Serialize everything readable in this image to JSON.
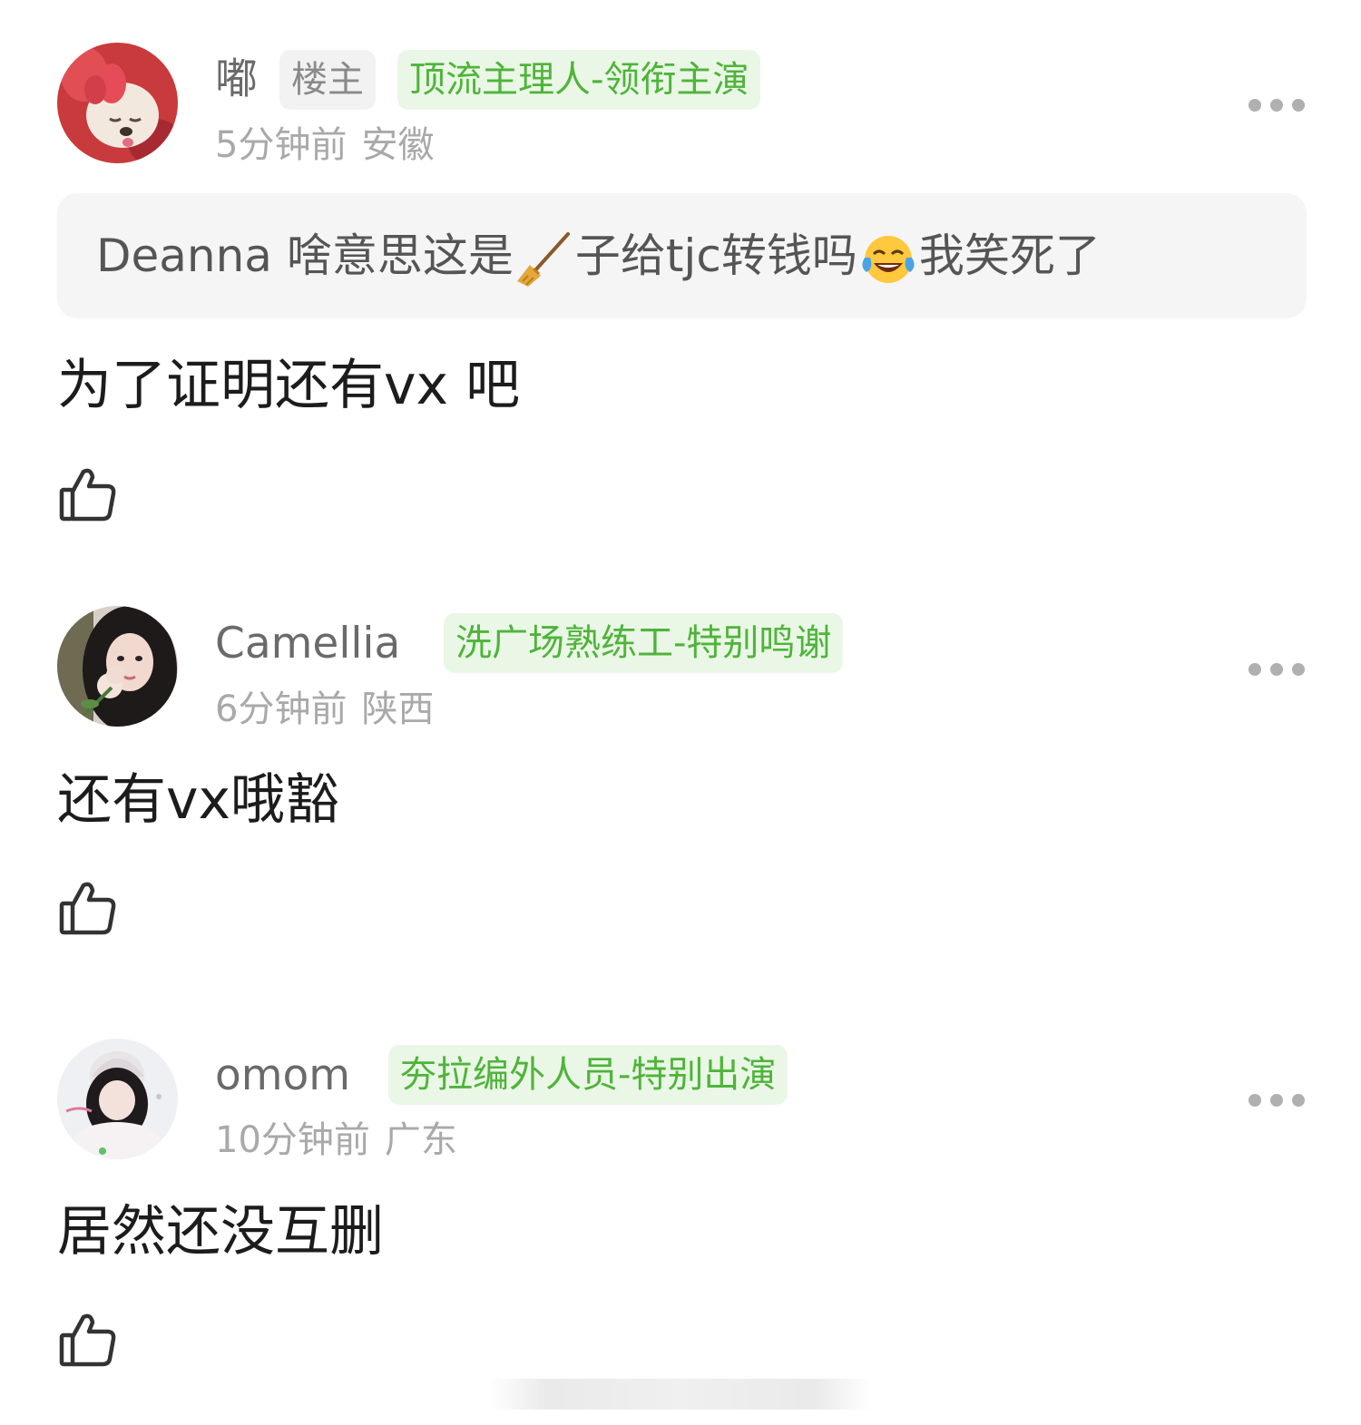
{
  "comments": [
    {
      "name": "嘟",
      "badges": [
        "楼主",
        "顶流主理人-领衔主演"
      ],
      "time": "5分钟前",
      "location": "安徽",
      "quote": {
        "author": "Deanna",
        "text_before": "啥意思这是",
        "emoji1": "broom-icon",
        "text_middle": "子给tjc转钱吗",
        "emoji2": "tears-of-joy-icon",
        "text_after": "我笑死了"
      },
      "text": "为了证明还有vx 吧"
    },
    {
      "name": "Camellia",
      "badges": [
        "洗广场熟练工-特别鸣谢"
      ],
      "time": "6分钟前",
      "location": "陕西",
      "text": "还有vx哦豁"
    },
    {
      "name": "omom",
      "badges": [
        "夯拉编外人员-特别出演"
      ],
      "time": "10分钟前",
      "location": "广东",
      "text": "居然还没互删"
    }
  ],
  "icons": {
    "like": "thumbs-up-icon",
    "more": "more-dots-icon"
  },
  "colors": {
    "badge_green_bg": "#eaf7e6",
    "badge_green_text": "#4fb43a",
    "badge_gray_bg": "#f2f2f2",
    "meta_text": "#a9a9a9"
  }
}
